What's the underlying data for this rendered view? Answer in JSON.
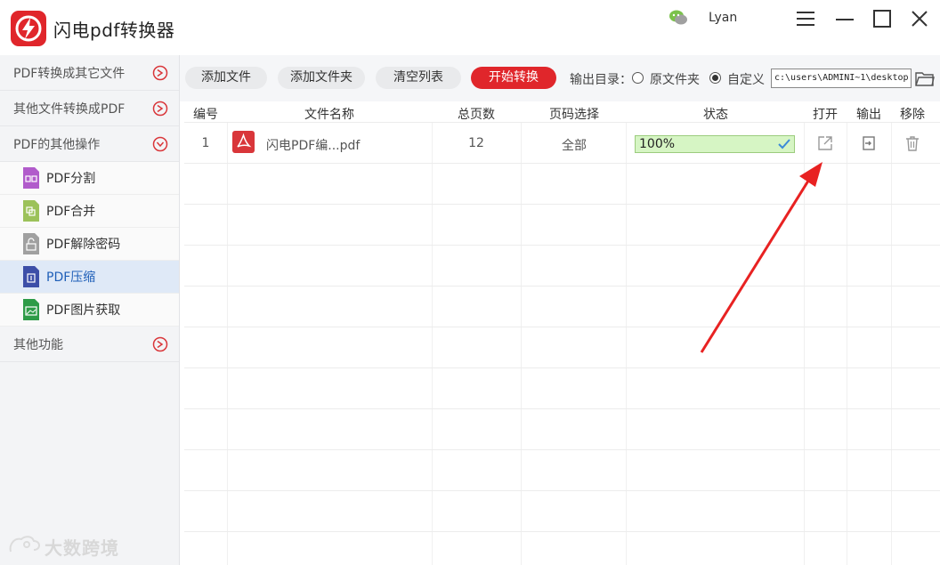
{
  "app": {
    "title": "闪电pdf转换器",
    "user": "Lyan",
    "accent": "#e0262b"
  },
  "sidebar": {
    "categories": [
      {
        "label": "PDF转换成其它文件",
        "state": "collapsed"
      },
      {
        "label": "其他文件转换成PDF",
        "state": "collapsed"
      },
      {
        "label": "PDF的其他操作",
        "state": "expanded"
      }
    ],
    "subitems": [
      {
        "label": "PDF分割",
        "icon": "split-icon",
        "color": "#b15bcb"
      },
      {
        "label": "PDF合并",
        "icon": "merge-icon",
        "color": "#9cc25a"
      },
      {
        "label": "PDF解除密码",
        "icon": "unlock-icon",
        "color": "#9a9a9a"
      },
      {
        "label": "PDF压缩",
        "icon": "compress-icon",
        "color": "#3d4fa8",
        "active": true
      },
      {
        "label": "PDF图片获取",
        "icon": "image-extract-icon",
        "color": "#2e9b47"
      }
    ],
    "last_category": {
      "label": "其他功能",
      "state": "collapsed"
    }
  },
  "toolbar": {
    "add_file": "添加文件",
    "add_folder": "添加文件夹",
    "clear_list": "清空列表",
    "start": "开始转换",
    "output_label": "输出目录：",
    "opt_original": "原文件夹",
    "opt_custom": "自定义",
    "selected_option": "自定义",
    "path": "c:\\users\\ADMINI~1\\desktop"
  },
  "table": {
    "headers": [
      "编号",
      "文件名称",
      "总页数",
      "页码选择",
      "状态",
      "打开",
      "输出",
      "移除"
    ],
    "rows": [
      {
        "num": "1",
        "name": "闪电PDF编...pdf",
        "pages": "12",
        "range": "全部",
        "status": "100%"
      }
    ]
  },
  "watermark": {
    "text": "大数跨境"
  }
}
